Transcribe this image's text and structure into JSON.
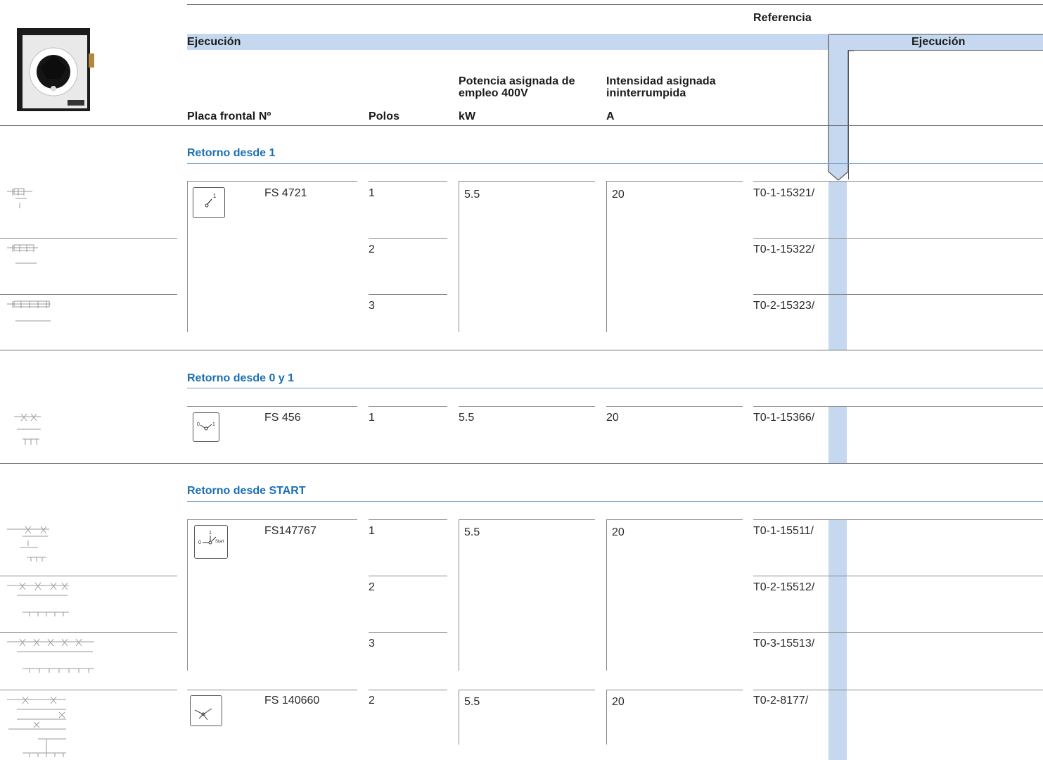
{
  "header": {
    "referencia": "Referencia",
    "ejecucion_left": "Ejecución",
    "ejecucion_right": "Ejecución",
    "columns": {
      "placa": "Placa frontal Nº",
      "polos": "Polos",
      "potencia": "Potencia asignada de empleo 400V",
      "potencia_unit": "kW",
      "intensidad": "Intensidad asignada ininterrumpida",
      "intensidad_unit": "A"
    }
  },
  "sections": [
    {
      "title": "Retorno desde 1",
      "plates": [
        {
          "plate_no": "FS 4721",
          "power": "5.5",
          "current": "20",
          "rows": [
            {
              "poles": "1",
              "ref": "T0-1-15321/"
            },
            {
              "poles": "2",
              "ref": "T0-1-15322/"
            },
            {
              "poles": "3",
              "ref": "T0-2-15323/"
            }
          ]
        }
      ]
    },
    {
      "title": "Retorno desde 0 y 1",
      "plates": [
        {
          "plate_no": "FS 456",
          "power": "5.5",
          "current": "20",
          "rows": [
            {
              "poles": "1",
              "ref": "T0-1-15366/"
            }
          ]
        }
      ]
    },
    {
      "title": "Retorno desde START",
      "plates": [
        {
          "plate_no": "FS147767",
          "power": "5.5",
          "current": "20",
          "rows": [
            {
              "poles": "1",
              "ref": "T0-1-15511/"
            },
            {
              "poles": "2",
              "ref": "T0-2-15512/"
            },
            {
              "poles": "3",
              "ref": "T0-3-15513/"
            }
          ]
        },
        {
          "plate_no": "FS 140660",
          "power": "5.5",
          "current": "20",
          "rows": [
            {
              "poles": "2",
              "ref": "T0-2-8177/"
            }
          ]
        }
      ]
    }
  ],
  "colors": {
    "accent_band": "#c5d8ef",
    "section_title": "#1a6fb5",
    "rule": "#8a8a8a"
  }
}
